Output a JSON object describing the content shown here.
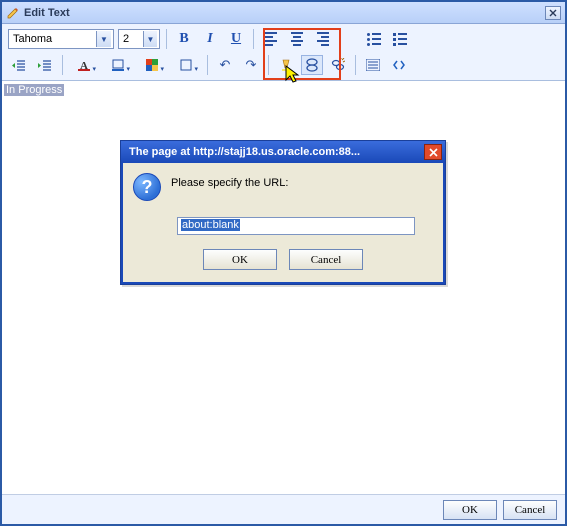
{
  "window": {
    "title": "Edit Text"
  },
  "toolbar": {
    "font_name": "Tahoma",
    "font_size": "2"
  },
  "content": {
    "selected_text": "In Progress"
  },
  "prompt": {
    "title": "The page at http://stajj18.us.oracle.com:88...",
    "message": "Please specify the URL:",
    "value": "about:blank",
    "ok_label": "OK",
    "cancel_label": "Cancel"
  },
  "footer": {
    "ok_label": "OK",
    "cancel_label": "Cancel"
  }
}
